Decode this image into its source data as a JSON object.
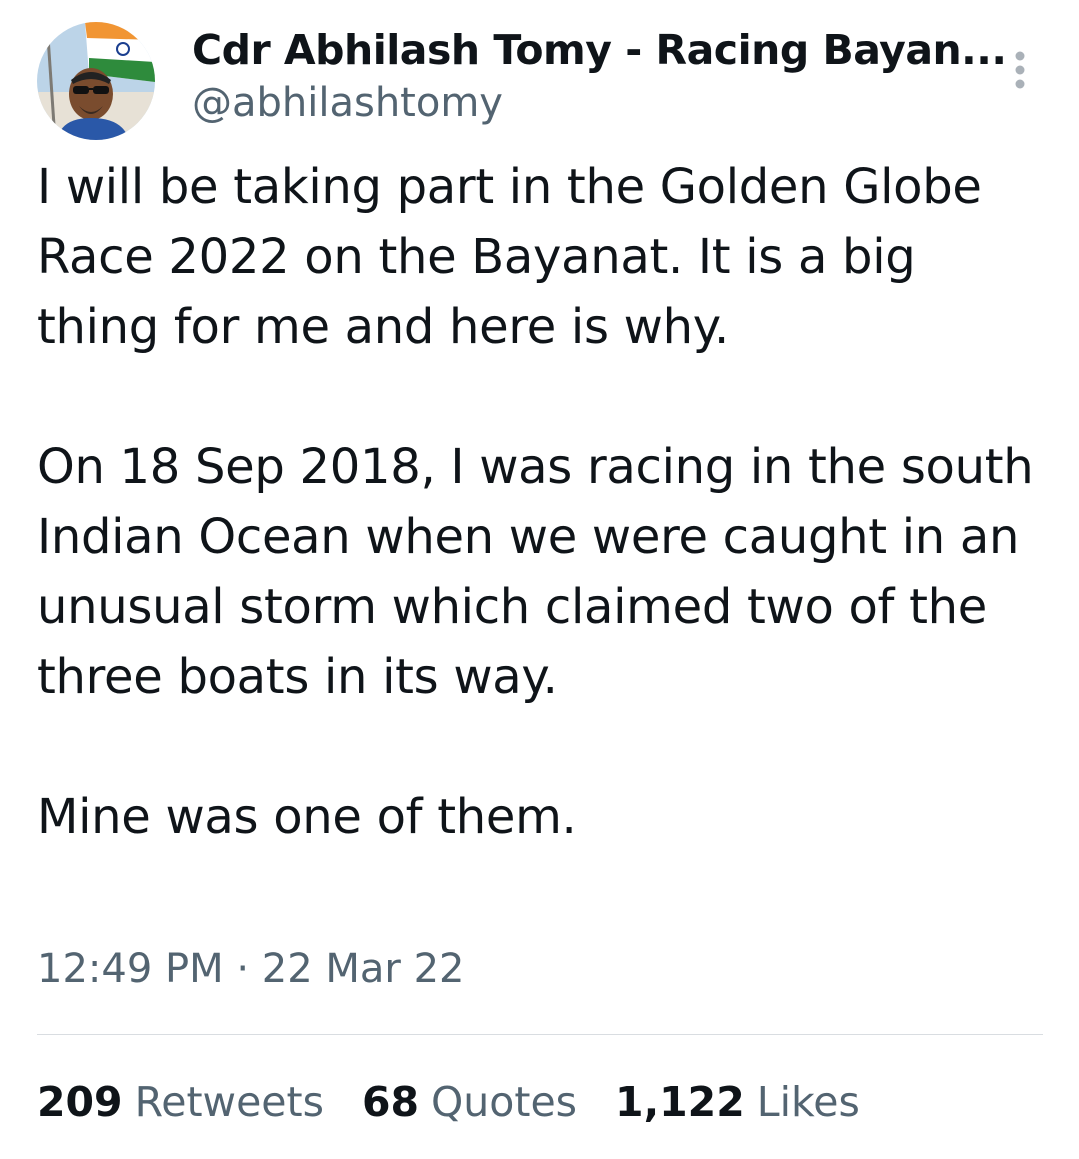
{
  "author": {
    "display_name": "Cdr Abhilash Tomy - Racing Bayan...",
    "handle": "@abhilashtomy",
    "avatar_icon": "profile-photo"
  },
  "more_icon": "more-vertical-icon",
  "tweet": {
    "paragraphs": [
      "I will be taking part in the Golden Globe Race 2022 on the Bayanat. It is a big thing for me and here is why.",
      "On 18 Sep 2018, I was racing in the south Indian Ocean when we were caught in an unusual storm which claimed two of the three boats in its way.",
      "Mine was one of them."
    ],
    "timestamp": "12:49 PM · 22 Mar 22"
  },
  "stats": {
    "retweets_count": "209",
    "retweets_label": "Retweets",
    "quotes_count": "68",
    "quotes_label": "Quotes",
    "likes_count": "1,122",
    "likes_label": "Likes"
  },
  "colors": {
    "text_primary": "#0f1419",
    "text_secondary": "#536471",
    "divider": "#d9dde1"
  }
}
